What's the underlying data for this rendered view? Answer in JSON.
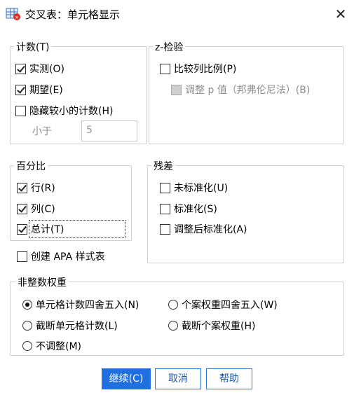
{
  "window": {
    "title": "交叉表：单元格显示",
    "close_glyph": "✕"
  },
  "counts": {
    "legend": "计数(T)",
    "observed": "实测(O)",
    "expected": "期望(E)",
    "hide_small": "隐藏较小的计数(H)",
    "less_than_label": "小于",
    "less_than_value": "5"
  },
  "z_test": {
    "legend": "z-检验",
    "compare": "比较列比例(P)",
    "adjust": "调整 p 值（邦弗伦尼法）(B)"
  },
  "percentages": {
    "legend": "百分比",
    "row": "行(R)",
    "column": "列(C)",
    "total": "总计(T)"
  },
  "residuals": {
    "legend": "残差",
    "unstandardized": "未标准化(U)",
    "standardized": "标准化(S)",
    "adjusted": "调整后标准化(A)"
  },
  "apa": {
    "label": "创建 APA 样式表"
  },
  "noninteger": {
    "legend": "非整数权重",
    "round_cell": "单元格计数四舍五入(N)",
    "round_case": "个案权重四舍五入(W)",
    "truncate_cell": "截断单元格计数(L)",
    "truncate_case": "截断个案权重(H)",
    "no_adjust": "不调整(M)"
  },
  "buttons": {
    "continue": "继续(C)",
    "cancel": "取消",
    "help": "帮助"
  },
  "colors": {
    "accent": "#1f6fe0",
    "border": "#cfcfcf"
  }
}
